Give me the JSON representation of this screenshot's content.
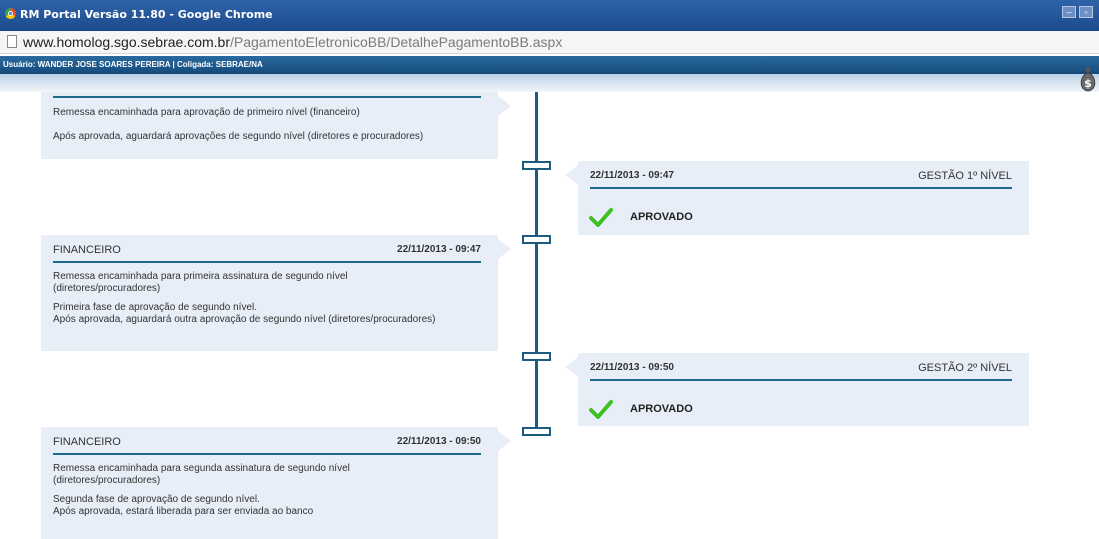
{
  "window": {
    "title": "RM Portal Versão 11.80 - Google Chrome",
    "minimize_glyph": "–",
    "restore_glyph": "▫"
  },
  "address": {
    "domain": "www.homolog.sgo.sebrae.com.br",
    "path": "/PagamentoEletronicoBB/DetalhePagamentoBB.aspx"
  },
  "userbar": {
    "text": "Usuário: WANDER JOSE SOARES PEREIRA | Coligada: SEBRAE/NA"
  },
  "icons": {
    "money_bag": "money-bag-icon",
    "money_symbol": "$"
  },
  "colors": {
    "timeline": "#1d5c7f",
    "card_bg": "#e8eef8",
    "check": "#3ec024",
    "titlebar": "#1c4b8e"
  },
  "timeline": {
    "cards": [
      {
        "side": "left",
        "lines": [
          "Remessa encaminhada para aprovação de primeiro nível (financeiro)",
          "Após aprovada, aguardará aprovações de segundo nível (diretores e procuradores)"
        ]
      },
      {
        "side": "right",
        "date": "22/11/2013 - 09:47",
        "role": "GESTÃO 1º NÍVEL",
        "status": "APROVADO"
      },
      {
        "side": "left",
        "role": "FINANCEIRO",
        "date": "22/11/2013 - 09:47",
        "lines": [
          "Remessa encaminhada para primeira assinatura de segundo nível",
          "(diretores/procuradores)",
          "Primeira fase de aprovação de segundo nível.",
          "Após aprovada, aguardará outra aprovação de segundo nível (diretores/procuradores)"
        ]
      },
      {
        "side": "right",
        "date": "22/11/2013 - 09:50",
        "role": "GESTÃO 2º NÍVEL",
        "status": "APROVADO"
      },
      {
        "side": "left",
        "role": "FINANCEIRO",
        "date": "22/11/2013 - 09:50",
        "lines": [
          "Remessa encaminhada para segunda assinatura de segundo nível",
          "(diretores/procuradores)",
          "Segunda fase de aprovação de segundo nível.",
          "Após aprovada, estará liberada para ser enviada ao banco"
        ]
      }
    ]
  }
}
